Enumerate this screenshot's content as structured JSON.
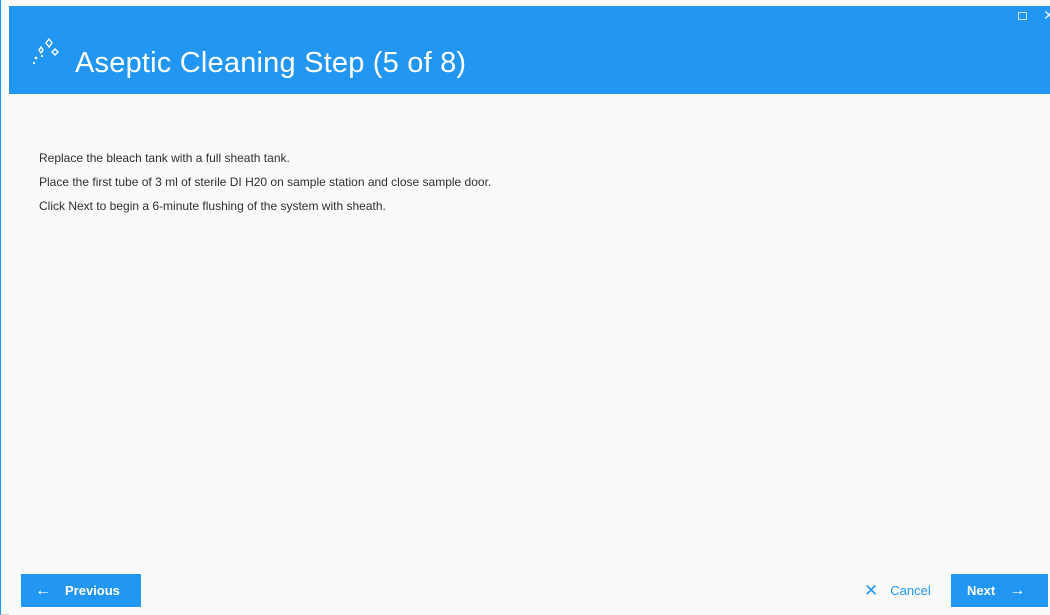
{
  "window": {
    "title": "Aseptic Cleaning Step (5 of 8)",
    "icon": "sparkle-wizard-icon",
    "accent_color": "#2196f3"
  },
  "instructions": [
    "Replace the bleach tank with a full sheath tank.",
    "Place the first tube of 3 ml of sterile DI H20 on sample station and close sample door.",
    "Click Next to begin a 6-minute flushing of the system with sheath."
  ],
  "footer": {
    "previous_label": "Previous",
    "cancel_label": "Cancel",
    "next_label": "Next"
  }
}
